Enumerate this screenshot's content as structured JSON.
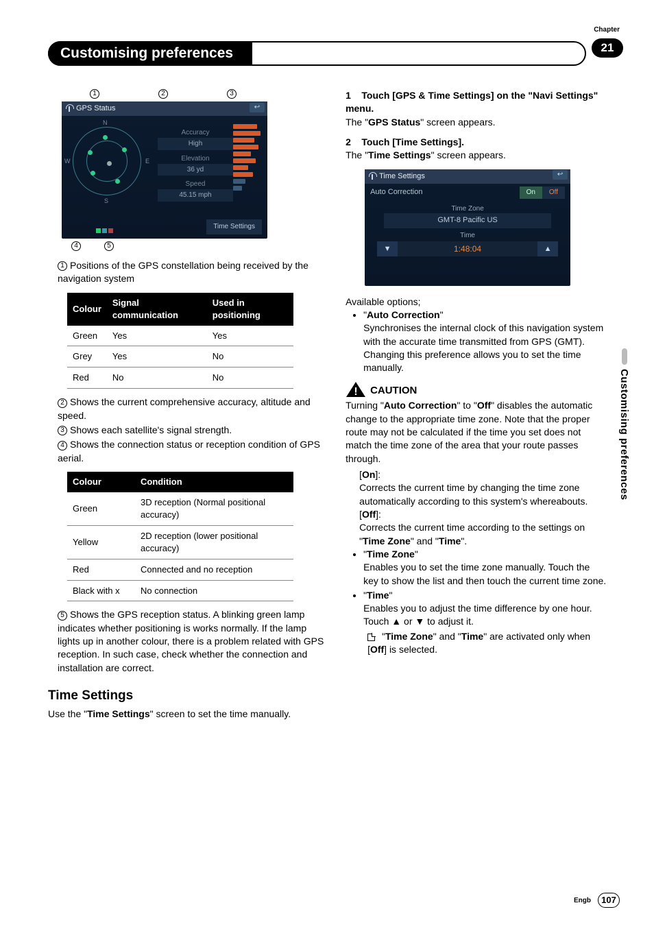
{
  "chapter": {
    "label": "Chapter",
    "number": "21"
  },
  "title": "Customising preferences",
  "sideTab": "Customising preferences",
  "footer": {
    "lang": "Engb",
    "page": "107"
  },
  "markers": {
    "m1": "1",
    "m2": "2",
    "m3": "3",
    "m4": "4",
    "m5": "5"
  },
  "shot1": {
    "title": "GPS Status",
    "compass": {
      "n": "N",
      "s": "S",
      "e": "E",
      "w": "W"
    },
    "accuracy_label": "Accuracy",
    "accuracy_value": "High",
    "elevation_label": "Elevation",
    "elevation_value": "36 yd",
    "speed_label": "Speed",
    "speed_value": "45.15 mph",
    "time_settings_btn": "Time Settings",
    "back": "↩"
  },
  "list1": {
    "i1": "Positions of the GPS constellation being received by the navigation system",
    "i2": "Shows the current comprehensive accuracy, altitude and speed.",
    "i3": "Shows each satellite's signal strength.",
    "i4": "Shows the connection status or reception condition of GPS aerial.",
    "i5": "Shows the GPS reception status. A blinking green lamp indicates whether positioning is works normally. If the lamp lights up in another colour, there is a problem related with GPS reception. In such case, check whether the connection and installation are correct."
  },
  "table1": {
    "h1": "Colour",
    "h2": "Signal communication",
    "h3": "Used in positioning",
    "r1c1": "Green",
    "r1c2": "Yes",
    "r1c3": "Yes",
    "r2c1": "Grey",
    "r2c2": "Yes",
    "r2c3": "No",
    "r3c1": "Red",
    "r3c2": "No",
    "r3c3": "No"
  },
  "table2": {
    "h1": "Colour",
    "h2": "Condition",
    "r1c1": "Green",
    "r1c2": "3D reception (Normal positional accuracy)",
    "r2c1": "Yellow",
    "r2c2": "2D reception (lower positional accuracy)",
    "r3c1": "Red",
    "r3c2": "Connected and no reception",
    "r4c1": "Black with x",
    "r4c2": "No connection"
  },
  "timeSettings": {
    "heading": "Time Settings",
    "intro_a": "Use the \"",
    "intro_b": "Time Settings",
    "intro_c": "\" screen to set the time manually."
  },
  "right": {
    "step1_num": "1",
    "step1_a": "Touch [GPS & Time Settings] on the \"Navi Settings\" menu.",
    "step1_body_a": "The \"",
    "step1_body_b": "GPS Status",
    "step1_body_c": "\" screen appears.",
    "step2_num": "2",
    "step2_a": "Touch [Time Settings].",
    "step2_body_a": "The \"",
    "step2_body_b": "Time Settings",
    "step2_body_c": "\" screen appears.",
    "available": "Available options;",
    "ac_label": "Auto Correction",
    "ac_body": "Synchronises the internal clock of this navigation system with the accurate time transmitted from GPS (GMT). Changing this preference allows you to set the time manually.",
    "caution": "CAUTION",
    "caution_a": "Turning \"",
    "caution_b": "Auto Correction",
    "caution_c": "\" to \"",
    "caution_d": "Off",
    "caution_e": "\" disables the automatic change to the appropriate time zone. Note that the proper route may not be calculated if the time you set does not match the time zone of the area that your route passes through.",
    "on_label": "On",
    "on_body": "Corrects the current time by changing the time zone automatically according to this system's whereabouts.",
    "off_label": "Off",
    "off_body_a": "Corrects the current time according to the settings on \"",
    "off_body_b": "Time Zone",
    "off_body_c": "\" and \"",
    "off_body_d": "Time",
    "off_body_e": "\".",
    "tz_label": "Time Zone",
    "tz_body": "Enables you to set the time zone manually. Touch the key to show the list and then touch the current time zone.",
    "time_label": "Time",
    "time_body_a": "Enables you to adjust the time difference by one hour. Touch ▲ or ▼ to adjust it.",
    "note_a": "\"",
    "note_b": "Time Zone",
    "note_c": "\" and \"",
    "note_d": "Time",
    "note_e": "\" are activated only when [",
    "note_f": "Off",
    "note_g": "] is selected."
  },
  "shot2": {
    "title": "Time Settings",
    "auto_label": "Auto Correction",
    "on": "On",
    "off": "Off",
    "tz_label": "Time Zone",
    "tz_value": "GMT-8 Pacific US",
    "time_label": "Time",
    "time_value": "1:48:04",
    "down": "▼",
    "up": "▲",
    "back": "↩"
  }
}
